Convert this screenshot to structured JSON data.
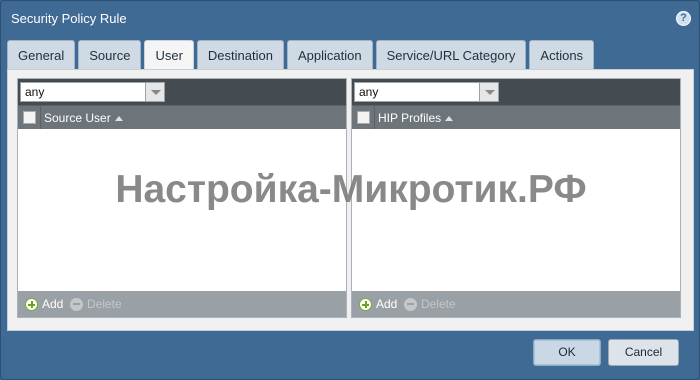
{
  "dialog": {
    "title": "Security Policy Rule"
  },
  "tabs": [
    {
      "label": "General"
    },
    {
      "label": "Source"
    },
    {
      "label": "User",
      "active": true
    },
    {
      "label": "Destination"
    },
    {
      "label": "Application"
    },
    {
      "label": "Service/URL Category"
    },
    {
      "label": "Actions"
    }
  ],
  "left_panel": {
    "select_value": "any",
    "column_header": "Source User",
    "add_label": "Add",
    "delete_label": "Delete"
  },
  "right_panel": {
    "select_value": "any",
    "column_header": "HIP Profiles",
    "add_label": "Add",
    "delete_label": "Delete"
  },
  "watermark": "Настройка-Микротик.РФ",
  "buttons": {
    "ok": "OK",
    "cancel": "Cancel"
  },
  "colors": {
    "dialog_bg": "#3f6a93",
    "panel_header": "#444c52",
    "column_header": "#6d757b",
    "footer": "#9aa1a6"
  }
}
